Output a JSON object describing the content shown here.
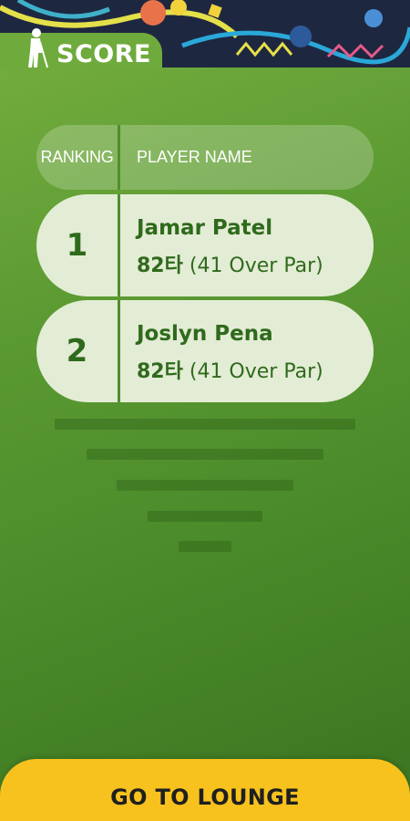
{
  "header": {
    "title": "SCORE",
    "icon": "golfer-icon"
  },
  "table": {
    "columns": {
      "ranking": "RANKING",
      "player_name": "PLAYER NAME"
    },
    "rows": [
      {
        "rank": "1",
        "name": "Jamar Patel",
        "strokes": "82타",
        "par_note": "(41 Over Par)"
      },
      {
        "rank": "2",
        "name": "Joslyn Pena",
        "strokes": "82타",
        "par_note": "(41 Over Par)"
      }
    ]
  },
  "footer": {
    "button_label": "GO TO LOUNGE"
  },
  "colors": {
    "background_green": "#5b9a32",
    "row_fill": "#e3ecd5",
    "text_green": "#2f6a1c",
    "button_yellow": "#f7c21e",
    "banner_navy": "#1e2740"
  }
}
